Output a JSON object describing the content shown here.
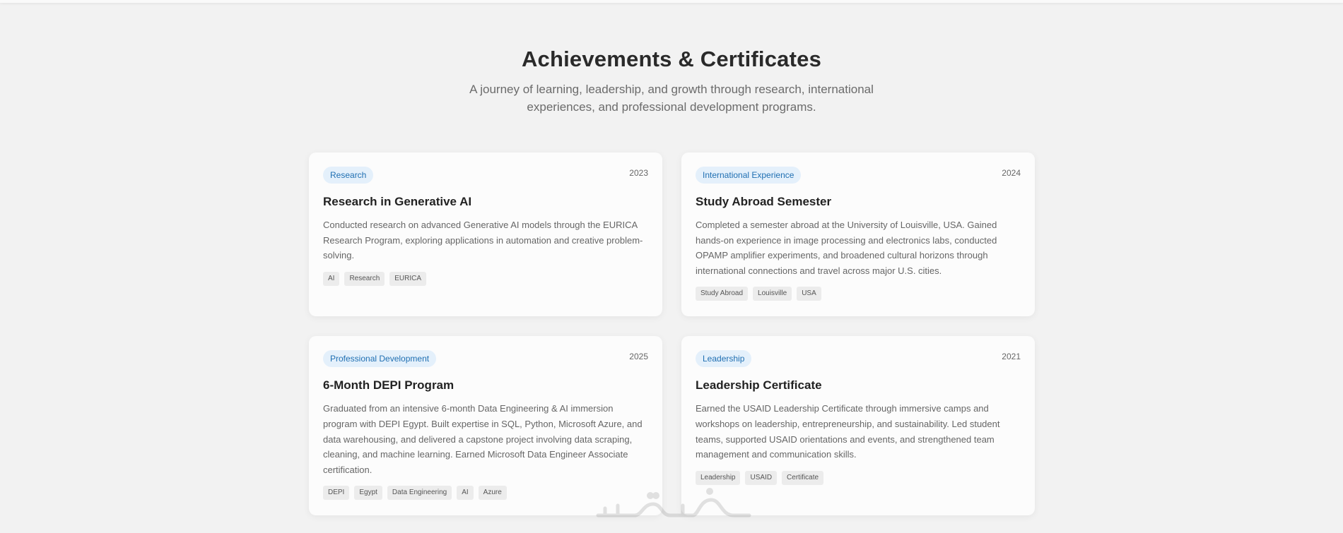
{
  "header": {
    "title": "Achievements & Certificates",
    "subtitle": "A journey of learning, leadership, and growth through research, international experiences, and professional development programs."
  },
  "cards": [
    {
      "category": "Research",
      "year": "2023",
      "title": "Research in Generative AI",
      "description": "Conducted research on advanced Generative AI models through the EURICA Research Program, exploring applications in automation and creative problem-solving.",
      "tags": [
        "AI",
        "Research",
        "EURICA"
      ]
    },
    {
      "category": "International Experience",
      "year": "2024",
      "title": "Study Abroad Semester",
      "description": "Completed a semester abroad at the University of Louisville, USA. Gained hands-on experience in image processing and electronics labs, conducted OPAMP amplifier experiments, and broadened cultural horizons through international connections and travel across major U.S. cities.",
      "tags": [
        "Study Abroad",
        "Louisville",
        "USA"
      ]
    },
    {
      "category": "Professional Development",
      "year": "2025",
      "title": "6-Month DEPI Program",
      "description": "Graduated from an intensive 6-month Data Engineering & AI immersion program with DEPI Egypt. Built expertise in SQL, Python, Microsoft Azure, and data warehousing, and delivered a capstone project involving data scraping, cleaning, and machine learning. Earned Microsoft Data Engineer Associate certification.",
      "tags": [
        "DEPI",
        "Egypt",
        "Data Engineering",
        "AI",
        "Azure"
      ]
    },
    {
      "category": "Leadership",
      "year": "2021",
      "title": "Leadership Certificate",
      "description": "Earned the USAID Leadership Certificate through immersive camps and workshops on leadership, entrepreneurship, and sustainability. Led student teams, supported USAID orientations and events, and strengthened team management and communication skills.",
      "tags": [
        "Leadership",
        "USAID",
        "Certificate"
      ]
    }
  ],
  "colors": {
    "background": "#f2f2f2",
    "card": "#fcfcfc",
    "category_bg": "#e4f0fb",
    "category_text": "#1f6fb2"
  },
  "watermark": {
    "text": "خمسات"
  }
}
